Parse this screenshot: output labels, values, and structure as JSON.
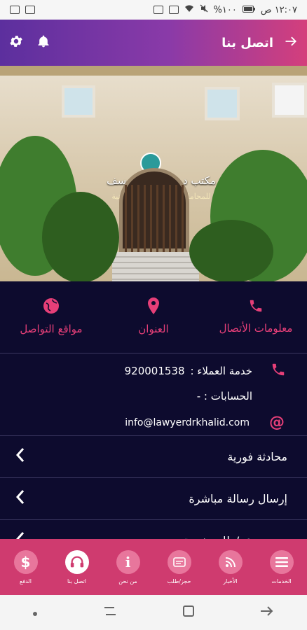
{
  "status_bar": {
    "time": "١٢:٠٧ ص",
    "battery": "%١٠٠"
  },
  "app_bar": {
    "title": "اتصل بنا"
  },
  "hero": {
    "sign_title": "مكتب د.خالد أمين يوسف",
    "sign_subtitle": "للمحاماة والإستشارات القانونية"
  },
  "tabs": [
    {
      "label": "معلومات الأتصال",
      "icon": "phone-icon"
    },
    {
      "label": "العنوان",
      "icon": "location-pin-icon"
    },
    {
      "label": "مواقع التواصل",
      "icon": "globe-icon"
    }
  ],
  "contact_info": {
    "customer_service_label": "خدمة العملاء :",
    "customer_service_number": "920001538",
    "accounts_label": "الحسابات : -",
    "email": "info@lawyerdrkhalid.com"
  },
  "list_items": [
    {
      "label": "محادثة فورية"
    },
    {
      "label": "إرسال رسالة مباشرة"
    },
    {
      "label": "حجز موعد/طلب خدمة"
    }
  ],
  "bottom_nav": [
    {
      "label": "الخدمات",
      "icon": "menu-icon"
    },
    {
      "label": "الأخبار",
      "icon": "rss-icon"
    },
    {
      "label": "حجز/طلب",
      "icon": "booking-icon"
    },
    {
      "label": "من نحن",
      "icon": "info-icon"
    },
    {
      "label": "اتصل بنا",
      "icon": "headset-icon"
    },
    {
      "label": "الدفع",
      "icon": "dollar-icon"
    }
  ],
  "colors": {
    "accent": "#e63f78",
    "background": "#0d0b2e",
    "bottom_nav": "#cf3b6f"
  }
}
